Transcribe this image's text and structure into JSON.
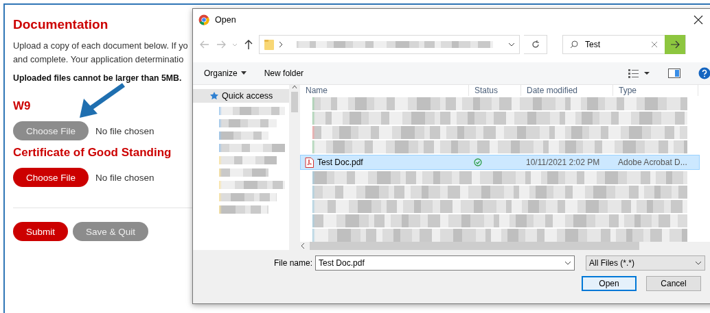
{
  "form": {
    "title": "Documentation",
    "intro_lines": [
      "Upload a copy of each document below. If yo",
      "and complete. Your application determinatio"
    ],
    "note": "Uploaded files cannot be larger than 5MB.",
    "sections": [
      {
        "heading": "W9",
        "button": "Choose File",
        "kind": "secondary",
        "status": "No file chosen"
      },
      {
        "heading": "Certificate of Good Standing",
        "button": "Choose File",
        "kind": "primary",
        "status": "No file chosen"
      }
    ],
    "actions": [
      {
        "label": "Submit",
        "kind": "primary"
      },
      {
        "label": "Save & Quit",
        "kind": "secondary"
      }
    ]
  },
  "dialog": {
    "title": "Open",
    "search": {
      "value": "Test"
    },
    "toolbar": [
      "Organize",
      "New folder"
    ],
    "nav": [
      {
        "label": "Quick access",
        "selected": true
      }
    ],
    "columns": [
      "Name",
      "Status",
      "Date modified",
      "Type"
    ],
    "file": {
      "name": "Test Doc.pdf",
      "date": "10/11/2021 2:02 PM",
      "type": "Adobe Acrobat D...",
      "selected": true
    },
    "file_name_label": "File name:",
    "file_name": "Test Doc.pdf",
    "filter": "All Files (*.*)",
    "buttons": [
      {
        "label": "Open",
        "kind": "default"
      },
      {
        "label": "Cancel",
        "kind": "normal"
      }
    ]
  }
}
